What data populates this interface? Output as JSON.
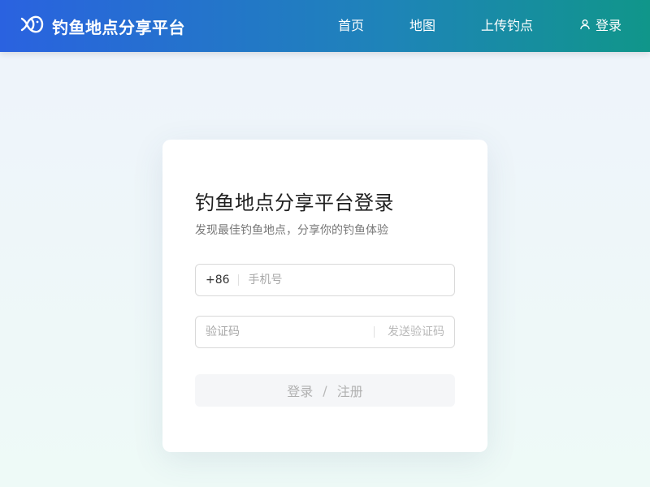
{
  "header": {
    "brand_name": "钓鱼地点分享平台",
    "nav": {
      "home": "首页",
      "map": "地图",
      "upload": "上传钓点",
      "login": "登录"
    }
  },
  "login_card": {
    "title": "钓鱼地点分享平台登录",
    "subtitle": "发现最佳钓鱼地点，分享你的钓鱼体验",
    "phone": {
      "prefix": "+86",
      "placeholder": "手机号",
      "value": ""
    },
    "code": {
      "placeholder": "验证码",
      "value": "",
      "send_label": "发送验证码"
    },
    "submit": {
      "login": "登录",
      "separator": "/",
      "register": "注册"
    }
  },
  "colors": {
    "header_start": "#2a62e0",
    "header_end": "#10968a",
    "disabled_text": "#b0b0b0"
  },
  "icons": {
    "brand": "fish-logo-icon",
    "login": "user-icon"
  }
}
